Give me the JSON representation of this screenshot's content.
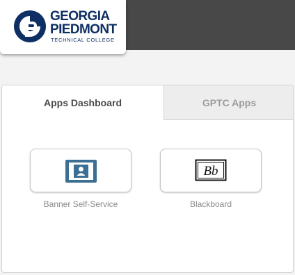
{
  "logo": {
    "line1": "GEORGIA",
    "line2": "PIEDMONT",
    "line3": "TECHNICAL COLLEGE"
  },
  "tabs": [
    {
      "label": "Apps Dashboard",
      "active": true
    },
    {
      "label": "GPTC Apps",
      "active": false
    }
  ],
  "apps": [
    {
      "label": "Banner Self-Service",
      "icon": "banner-self-service-icon"
    },
    {
      "label": "Blackboard",
      "icon": "blackboard-logo-icon",
      "icon_text": "Bb"
    }
  ],
  "colors": {
    "brand_navy": "#0e2f63",
    "topbar": "#484848",
    "banner_icon": "#3b6f93"
  }
}
